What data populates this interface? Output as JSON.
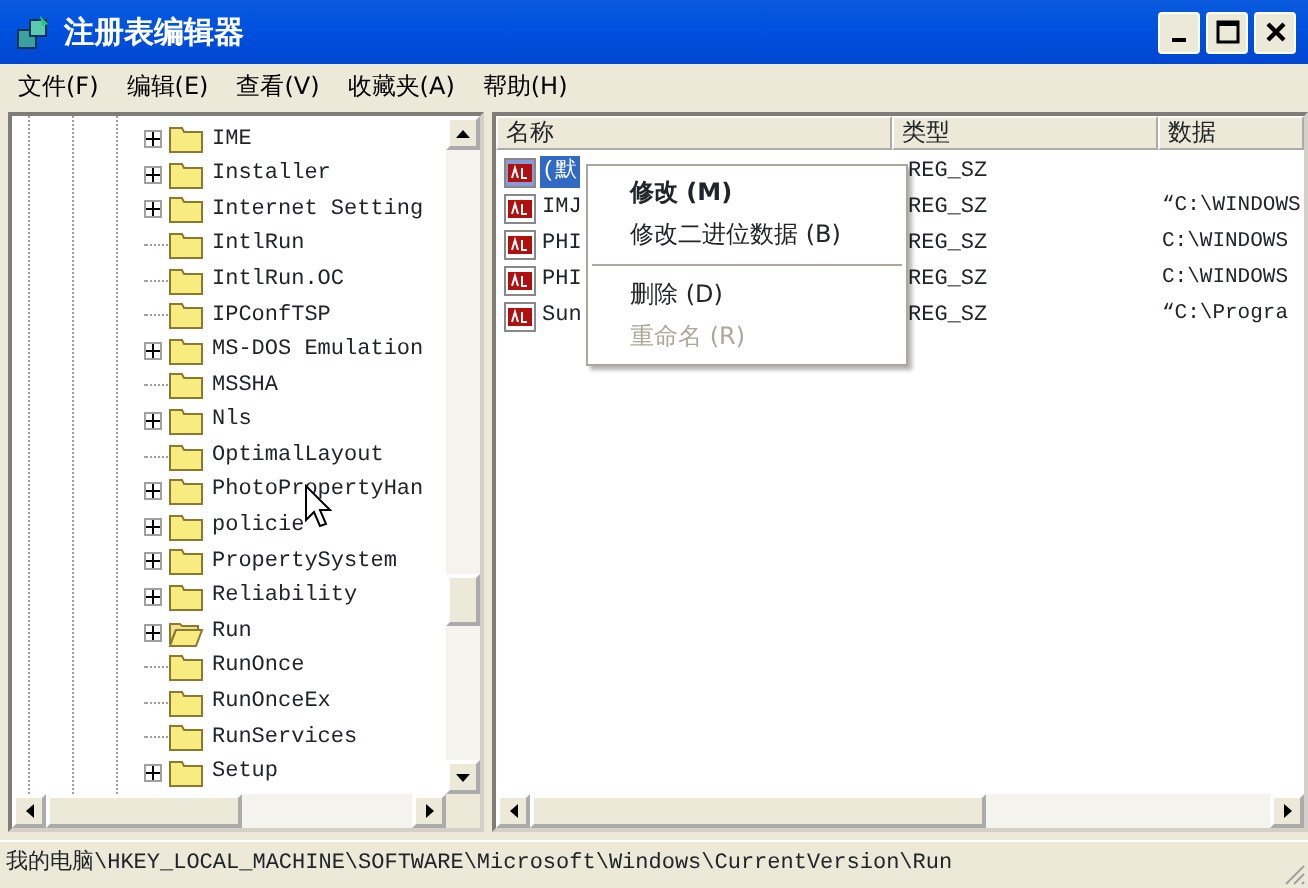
{
  "window": {
    "title": "注册表编辑器"
  },
  "menu": [
    "文件(F)",
    "编辑(E)",
    "查看(V)",
    "收藏夹(A)",
    "帮助(H)"
  ],
  "tree": [
    {
      "label": "IME",
      "has_children": true,
      "open": false
    },
    {
      "label": "Installer",
      "has_children": true,
      "open": false
    },
    {
      "label": "Internet Setting",
      "has_children": true,
      "open": false
    },
    {
      "label": "IntlRun",
      "has_children": false,
      "open": false
    },
    {
      "label": "IntlRun.OC",
      "has_children": false,
      "open": false
    },
    {
      "label": "IPConfTSP",
      "has_children": false,
      "open": false
    },
    {
      "label": "MS-DOS Emulation",
      "has_children": true,
      "open": false
    },
    {
      "label": "MSSHA",
      "has_children": false,
      "open": false
    },
    {
      "label": "Nls",
      "has_children": true,
      "open": false
    },
    {
      "label": "OptimalLayout",
      "has_children": false,
      "open": false
    },
    {
      "label": "PhotoPropertyHan",
      "has_children": true,
      "open": false
    },
    {
      "label": "policie",
      "has_children": true,
      "open": false
    },
    {
      "label": "PropertySystem",
      "has_children": true,
      "open": false
    },
    {
      "label": "Reliability",
      "has_children": true,
      "open": false
    },
    {
      "label": "Run",
      "has_children": true,
      "open": true
    },
    {
      "label": "RunOnce",
      "has_children": false,
      "open": false
    },
    {
      "label": "RunOnceEx",
      "has_children": false,
      "open": false
    },
    {
      "label": "RunServices",
      "has_children": false,
      "open": false
    },
    {
      "label": "Setup",
      "has_children": true,
      "open": false
    }
  ],
  "table": {
    "columns": [
      "名称",
      "类型",
      "数据"
    ],
    "rows": [
      {
        "name": "(默",
        "type": "REG_SZ",
        "data": "",
        "selected": true
      },
      {
        "name": "IMJ",
        "type": "REG_SZ",
        "data": "“C:\\WINDOWS",
        "selected": false
      },
      {
        "name": "PHI",
        "type": "REG_SZ",
        "data": "C:\\WINDOWS",
        "selected": false
      },
      {
        "name": "PHI",
        "type": "REG_SZ",
        "data": "C:\\WINDOWS",
        "selected": false
      },
      {
        "name": "Sun",
        "type": "REG_SZ",
        "data": "“C:\\Progra",
        "selected": false
      }
    ]
  },
  "context_menu": [
    {
      "kind": "item",
      "label": "修改 (M)",
      "default": true,
      "disabled": false
    },
    {
      "kind": "item",
      "label": "修改二进位数据 (B)",
      "default": false,
      "disabled": false
    },
    {
      "kind": "separator"
    },
    {
      "kind": "item",
      "label": "删除 (D)",
      "default": false,
      "disabled": false
    },
    {
      "kind": "item",
      "label": "重命名 (R)",
      "default": false,
      "disabled": true
    }
  ],
  "status_bar": "我的电脑\\HKEY_LOCAL_MACHINE\\SOFTWARE\\Microsoft\\Windows\\CurrentVersion\\Run"
}
